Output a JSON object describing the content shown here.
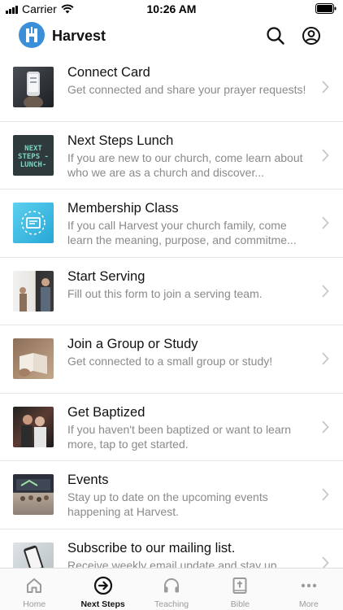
{
  "status_bar": {
    "carrier": "Carrier",
    "time": "10:26 AM"
  },
  "header": {
    "title": "Harvest",
    "logo_icon": "harvest-logo-icon",
    "accent": "#3b8fd9"
  },
  "items": [
    {
      "title": "Connect Card",
      "description": "Get connected and share your prayer requests!"
    },
    {
      "title": "Next Steps Lunch",
      "description": "If you are new to our church, come learn about who we are as a church and discover...",
      "thumb_text": "NEXT STEPS -LUNCH-"
    },
    {
      "title": "Membership Class",
      "description": "If you call Harvest your church family, come learn the meaning, purpose, and commitme..."
    },
    {
      "title": "Start Serving",
      "description": "Fill out this form to join a serving team."
    },
    {
      "title": "Join a Group or Study",
      "description": "Get connected to a small group or study!"
    },
    {
      "title": "Get Baptized",
      "description": "If you haven't been baptized or want to learn more, tap to get started."
    },
    {
      "title": "Events",
      "description": "Stay up to date on the upcoming events happening at Harvest."
    },
    {
      "title": "Subscribe to our mailing list.",
      "description": "Receive weekly email update and stay up"
    }
  ],
  "tabs": [
    {
      "label": "Home",
      "icon": "home-icon",
      "active": false
    },
    {
      "label": "Next Steps",
      "icon": "arrow-circle-icon",
      "active": true
    },
    {
      "label": "Teaching",
      "icon": "headphones-icon",
      "active": false
    },
    {
      "label": "Bible",
      "icon": "bible-icon",
      "active": false
    },
    {
      "label": "More",
      "icon": "more-dots-icon",
      "active": false
    }
  ]
}
